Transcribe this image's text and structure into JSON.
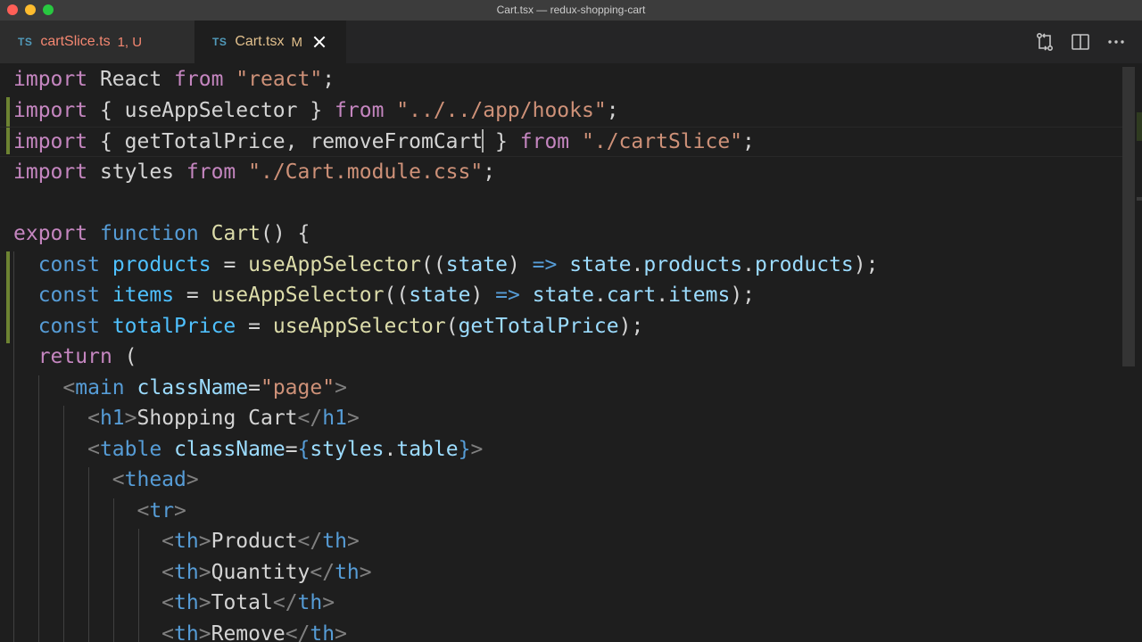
{
  "window": {
    "title": "Cart.tsx — redux-shopping-cart"
  },
  "tabs": [
    {
      "lang": "TS",
      "name": "cartSlice.ts",
      "badge": "1, U"
    },
    {
      "lang": "TS",
      "name": "Cart.tsx",
      "badge": "M"
    }
  ],
  "actions": [
    "source-control-compare-icon",
    "split-editor-icon",
    "more-actions-icon"
  ],
  "colors": {
    "keyword": "#c586c0",
    "storage": "#569cd6",
    "string": "#ce9178",
    "variable": "#9cdcfe",
    "function": "#dcdcaa",
    "type": "#4ec9b0",
    "tag_punct": "#808080",
    "modified_gutter": "#6d8332"
  },
  "code": {
    "l1": [
      "import",
      " React ",
      "from",
      " ",
      "\"react\"",
      ";"
    ],
    "l2": [
      "import",
      " { useAppSelector } ",
      "from",
      " ",
      "\"../../app/hooks\"",
      ";"
    ],
    "l3": [
      "import",
      " { getTotalPrice, removeFromCart",
      " }",
      " ",
      "from",
      " ",
      "\"./cartSlice\"",
      ";"
    ],
    "l4": [
      "import",
      " styles ",
      "from",
      " ",
      "\"./Cart.module.css\"",
      ";"
    ],
    "l6": [
      "export",
      " ",
      "function",
      " ",
      "Cart",
      "() {"
    ],
    "l7": [
      "  ",
      "const",
      " ",
      "products",
      " = ",
      "useAppSelector",
      "((",
      "state",
      ") ",
      "=>",
      " ",
      "state",
      ".",
      "products",
      ".",
      "products",
      ");"
    ],
    "l8": [
      "  ",
      "const",
      " ",
      "items",
      " = ",
      "useAppSelector",
      "((",
      "state",
      ") ",
      "=>",
      " ",
      "state",
      ".",
      "cart",
      ".",
      "items",
      ");"
    ],
    "l9": [
      "  ",
      "const",
      " ",
      "totalPrice",
      " = ",
      "useAppSelector",
      "(",
      "getTotalPrice",
      ");"
    ],
    "l10": [
      "  ",
      "return",
      " ("
    ],
    "l11": [
      "    ",
      "<",
      "main",
      " ",
      "className",
      "=",
      "\"page\"",
      ">"
    ],
    "l12": [
      "      ",
      "<",
      "h1",
      ">",
      "Shopping Cart",
      "</",
      "h1",
      ">"
    ],
    "l13": [
      "      ",
      "<",
      "table",
      " ",
      "className",
      "=",
      "{",
      "styles",
      ".",
      "table",
      "}",
      ">"
    ],
    "l14": [
      "        ",
      "<",
      "thead",
      ">"
    ],
    "l15": [
      "          ",
      "<",
      "tr",
      ">"
    ],
    "l16": [
      "            ",
      "<",
      "th",
      ">",
      "Product",
      "</",
      "th",
      ">"
    ],
    "l17": [
      "            ",
      "<",
      "th",
      ">",
      "Quantity",
      "</",
      "th",
      ">"
    ],
    "l18": [
      "            ",
      "<",
      "th",
      ">",
      "Total",
      "</",
      "th",
      ">"
    ],
    "l19": [
      "            ",
      "<",
      "th",
      ">",
      "Remove",
      "</",
      "th",
      ">"
    ]
  }
}
